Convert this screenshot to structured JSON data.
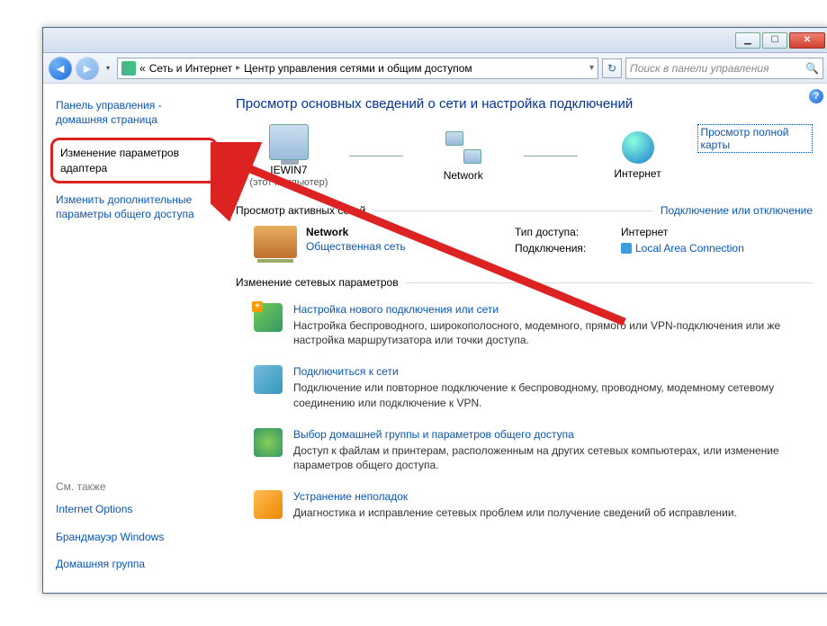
{
  "breadcrumb": {
    "prefix": "«",
    "level1": "Сеть и Интернет",
    "level2": "Центр управления сетями и общим доступом"
  },
  "search": {
    "placeholder": "Поиск в панели управления"
  },
  "sidebar": {
    "home": "Панель управления - домашняя страница",
    "adapter": "Изменение параметров адаптера",
    "sharing": "Изменить дополнительные параметры общего доступа",
    "seealso_hdr": "См. также",
    "seealso": [
      "Internet Options",
      "Брандмауэр Windows",
      "Домашняя группа"
    ]
  },
  "main": {
    "title": "Просмотр основных сведений о сети и настройка подключений",
    "map": {
      "pc_name": "IEWIN7",
      "pc_sub": "(этот компьютер)",
      "network": "Network",
      "internet": "Интернет",
      "fullmap": "Просмотр полной карты"
    },
    "active_hdr": "Просмотр активных сетей",
    "connect_link": "Подключение или отключение",
    "network": {
      "name": "Network",
      "type": "Общественная сеть",
      "access_k": "Тип доступа:",
      "access_v": "Интернет",
      "conn_k": "Подключения:",
      "conn_v": "Local Area Connection"
    },
    "change_hdr": "Изменение сетевых параметров",
    "tasks": [
      {
        "title": "Настройка нового подключения или сети",
        "desc": "Настройка беспроводного, широкополосного, модемного, прямого или VPN-подключения или же настройка маршрутизатора или точки доступа."
      },
      {
        "title": "Подключиться к сети",
        "desc": "Подключение или повторное подключение к беспроводному, проводному, модемному сетевому соединению или подключение к VPN."
      },
      {
        "title": "Выбор домашней группы и параметров общего доступа",
        "desc": "Доступ к файлам и принтерам, расположенным на других сетевых компьютерах, или изменение параметров общего доступа."
      },
      {
        "title": "Устранение неполадок",
        "desc": "Диагностика и исправление сетевых проблем или получение сведений об исправлении."
      }
    ]
  }
}
